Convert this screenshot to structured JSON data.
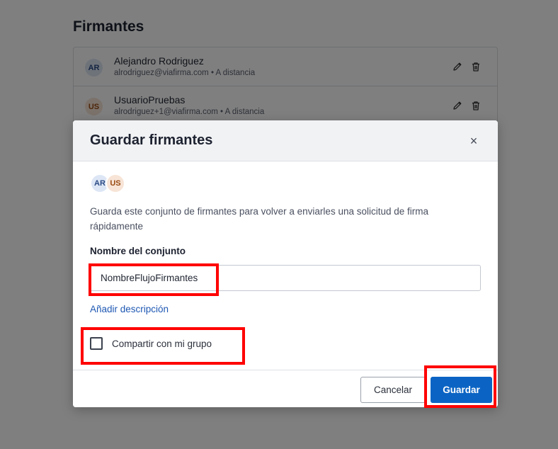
{
  "page": {
    "title": "Firmantes",
    "signers": [
      {
        "initials": "AR",
        "name": "Alejandro Rodriguez",
        "meta": "alrodriguez@viafirma.com • A distancia"
      },
      {
        "initials": "US",
        "name": "UsuarioPruebas",
        "meta": "alrodriguez+1@viafirma.com • A distancia"
      }
    ]
  },
  "modal": {
    "title": "Guardar firmantes",
    "close_symbol": "×",
    "avatars": [
      "AR",
      "US"
    ],
    "description": "Guarda este conjunto de firmantes para volver a enviarles una solicitud de firma rápidamente",
    "field_label": "Nombre del conjunto",
    "field_value": "NombreFlujoFirmantes",
    "add_description_link": "Añadir descripción",
    "share_checkbox_label": "Compartir con mi grupo",
    "share_checked": false,
    "cancel_label": "Cancelar",
    "save_label": "Guardar"
  },
  "colors": {
    "primary": "#0b64c4",
    "link": "#1e58b3",
    "highlight": "#ff0000",
    "overlay": "rgba(0,0,0,0.5)"
  },
  "icons": [
    "pencil-icon",
    "trash-icon",
    "close-icon"
  ]
}
